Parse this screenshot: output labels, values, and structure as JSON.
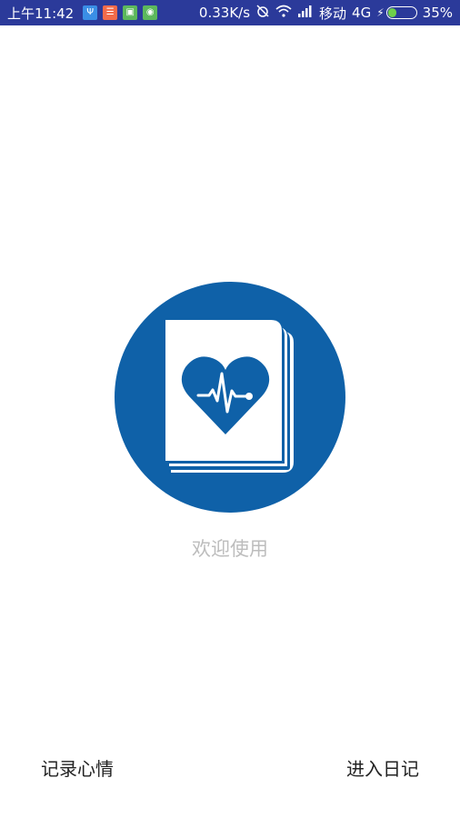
{
  "status_bar": {
    "time": "上午11:42",
    "notification_icons": [
      {
        "name": "usb-icon",
        "color": "#3a8ee6",
        "glyph": "Ψ"
      },
      {
        "name": "app-icon",
        "color": "#f26b4a",
        "glyph": "☰"
      },
      {
        "name": "lock-app-icon",
        "color": "#5cb85c",
        "glyph": "▣"
      },
      {
        "name": "android-icon",
        "color": "#5cb85c",
        "glyph": "◉"
      }
    ],
    "network_speed": "0.33K/s",
    "carrier": "移动",
    "network_type": "4G",
    "battery_percent": "35%",
    "battery_level": 0.35,
    "background_color": "#2b3a9a"
  },
  "logo": {
    "circle_color": "#0f61a8",
    "icon_name": "health-diary-book-icon"
  },
  "welcome_text": "欢迎使用",
  "buttons": {
    "record_mood": "记录心情",
    "enter_diary": "进入日记"
  }
}
